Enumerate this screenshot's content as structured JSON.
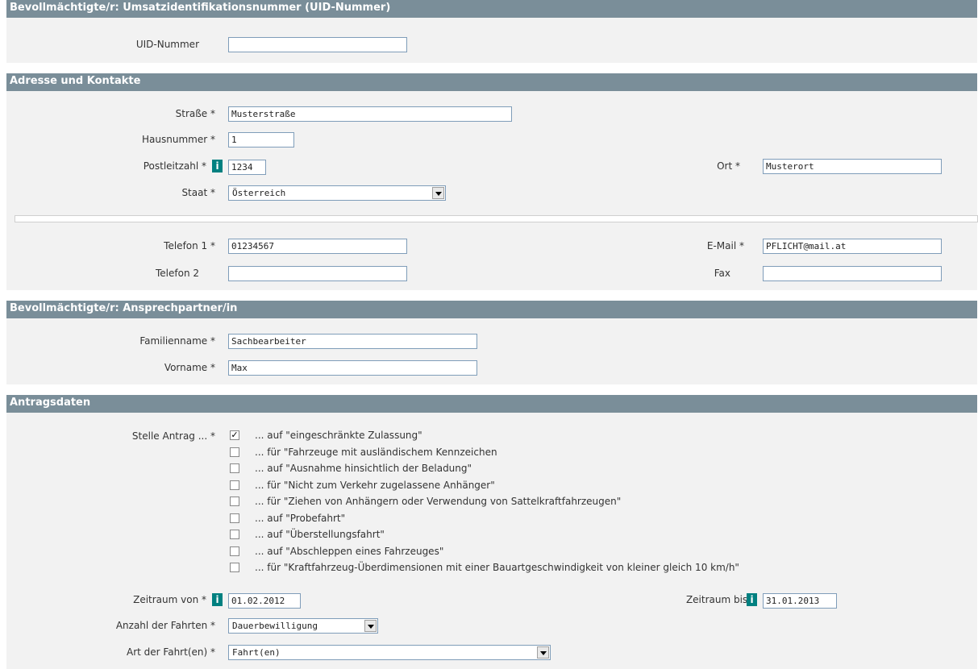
{
  "sections": {
    "uid": {
      "title": "Bevollmächtigte/r: Umsatzidentifikationsnummer (UID-Nummer)"
    },
    "address": {
      "title": "Adresse und Kontakte"
    },
    "contact": {
      "title": "Bevollmächtigte/r: Ansprechpartner/in"
    },
    "application": {
      "title": "Antragsdaten"
    }
  },
  "uid": {
    "label": "UID-Nummer",
    "value": ""
  },
  "address": {
    "street": {
      "label": "Straße *",
      "value": "Musterstraße"
    },
    "house_number": {
      "label": "Hausnummer *",
      "value": "1"
    },
    "postal_code": {
      "label": "Postleitzahl *",
      "value": "1234"
    },
    "city": {
      "label": "Ort *",
      "value": "Musterort"
    },
    "country": {
      "label": "Staat *",
      "value": "Österreich"
    },
    "phone1": {
      "label": "Telefon 1 *",
      "value": "01234567"
    },
    "phone2": {
      "label": "Telefon 2",
      "value": ""
    },
    "email": {
      "label": "E-Mail *",
      "value": "PFLICHT@mail.at"
    },
    "fax": {
      "label": "Fax",
      "value": ""
    }
  },
  "contact": {
    "last_name": {
      "label": "Familienname *",
      "value": "Sachbearbeiter"
    },
    "first_name": {
      "label": "Vorname *",
      "value": "Max"
    }
  },
  "application": {
    "request_label": "Stelle Antrag ... *",
    "options": [
      {
        "label": "... auf \"eingeschränkte Zulassung\"",
        "checked": true
      },
      {
        "label": "... für \"Fahrzeuge mit ausländischem Kennzeichen",
        "checked": false
      },
      {
        "label": "... auf \"Ausnahme hinsichtlich der Beladung\"",
        "checked": false
      },
      {
        "label": "... für \"Nicht zum Verkehr zugelassene Anhänger\"",
        "checked": false
      },
      {
        "label": "... für \"Ziehen von Anhängern oder Verwendung von Sattelkraftfahrzeugen\"",
        "checked": false
      },
      {
        "label": "... auf \"Probefahrt\"",
        "checked": false
      },
      {
        "label": "... auf \"Überstellungsfahrt\"",
        "checked": false
      },
      {
        "label": "... auf \"Abschleppen eines Fahrzeuges\"",
        "checked": false
      },
      {
        "label": "... für \"Kraftfahrzeug-Überdimensionen mit einer Bauartgeschwindigkeit von kleiner gleich 10 km/h\"",
        "checked": false
      }
    ],
    "period_from": {
      "label": "Zeitraum von *",
      "value": "01.02.2012"
    },
    "period_to": {
      "label": "Zeitraum bis *",
      "value": "31.01.2013"
    },
    "trip_count": {
      "label": "Anzahl der Fahrten *",
      "value": "Dauerbewilligung"
    },
    "trip_type": {
      "label": "Art der Fahrt(en) *",
      "value": "Fahrt(en)"
    }
  },
  "icons": {
    "info": "i",
    "checkmark": "✓"
  },
  "colors": {
    "section_header": "#7a8e99",
    "section_body": "#f2f2f2",
    "info_icon": "#008080",
    "input_border": "#7f9db9"
  }
}
